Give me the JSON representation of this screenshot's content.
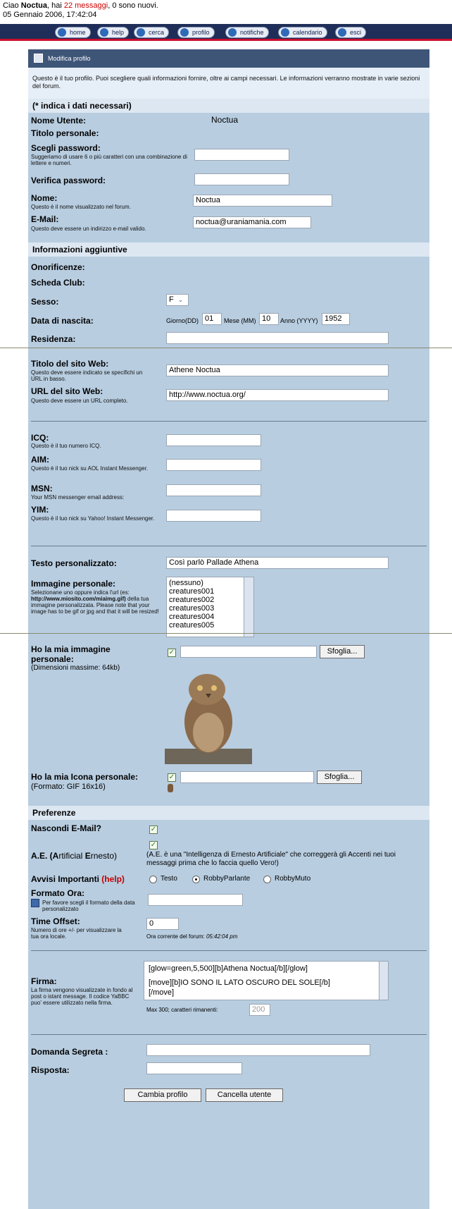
{
  "header": {
    "greeting_prefix": "Ciao ",
    "user": "Noctua",
    "greeting_mid": ", hai ",
    "messages": "22 messaggi",
    "greeting_suffix": ", 0 sono nuovi.",
    "datetime": "05 Gennaio 2006, 17:42:04"
  },
  "nav": [
    "home",
    "help",
    "cerca",
    "profilo",
    "notifiche",
    "calendario",
    "esci"
  ],
  "panel": {
    "title": "Modifica profilo",
    "intro": "Questo è il tuo profilo. Puoi scegliere quali informazioni fornire, oltre ai campi necessari. Le informazioni verranno mostrate in varie sezioni del forum."
  },
  "required": {
    "header": "(* indica i dati necessari)",
    "username_label": "Nome Utente:",
    "username_value": "Noctua",
    "title_label": "Titolo personale:",
    "password_label": "Scegli password:",
    "password_hint": "Suggeriamo di usare 6 o più caratteri con una combinazione di lettere e numeri.",
    "verify_label": "Verifica password:",
    "name_label": "Nome:",
    "name_hint": "Questo è il nome visualizzato nel forum.",
    "name_value": "Noctua",
    "email_label": "E-Mail:",
    "email_hint": "Questo deve essere un indirizzo e-mail valido.",
    "email_value": "noctua@uraniamania.com"
  },
  "extra": {
    "header": "Informazioni aggiuntive",
    "honors_label": "Onorificenze:",
    "club_label": "Scheda Club:",
    "sex_label": "Sesso:",
    "sex_value": "F",
    "birth_label": "Data di nascita:",
    "day_label": "Giorno(DD)",
    "day_value": "01",
    "month_label": "Mese (MM)",
    "month_value": "10",
    "year_label": "Anno (YYYY)",
    "year_value": "1952",
    "residence_label": "Residenza:",
    "site_title_label": "Titolo del sito Web:",
    "site_title_hint": "Questo deve essere indicato se specifichi un URL in basso.",
    "site_title_value": "Athene Noctua",
    "site_url_label": "URL del sito Web:",
    "site_url_hint": "Questo deve essere un URL completo.",
    "site_url_value": "http://www.noctua.org/",
    "icq_label": "ICQ:",
    "icq_hint": "Questo è il tuo numero ICQ.",
    "aim_label": "AIM:",
    "aim_hint": "Questo è il tuo nick su AOL Instant Messenger.",
    "msn_label": "MSN:",
    "msn_hint": "Your MSN messenger email address:",
    "yim_label": "YIM:",
    "yim_hint": "Questo è il tuo nick su Yahoo! Instant Messenger.",
    "custom_text_label": "Testo personalizzato:",
    "custom_text_value": "Così parlò Pallade Athena",
    "avatar_label": "Immagine personale:",
    "avatar_hint_1": "Selezionane uno oppure indica l'url (es:",
    "avatar_hint_url": "http://www.miosito.com/miaimg.gif)",
    "avatar_hint_2": "della tua immagine personalizzata. Please note that your image has to be gif or jpg and that it will be resized!",
    "avatar_options": [
      "(nessuno)",
      "creatures001",
      "creatures002",
      "creatures003",
      "creatures004",
      "creatures005"
    ],
    "own_image_label": "Ho la mia immagine personale:",
    "own_image_hint": "(Dimensioni massime: 64kb)",
    "browse_label": "Sfoglia...",
    "own_icon_label": "Ho la mia Icona personale:",
    "own_icon_hint": "(Formato: GIF 16x16)"
  },
  "prefs": {
    "header": "Preferenze",
    "hide_email_label": "Nascondi E-Mail?",
    "ae_label_1": "A.E. (",
    "ae_label_a": "A",
    "ae_label_2": "rtificial ",
    "ae_label_e": "E",
    "ae_label_3": "rnesto)",
    "ae_desc": "(A.E. è una \"Intelligenza di Ernesto Artificiale\" che correggerà gli Accenti nei tuoi messaggi prima che lo faccia quello Vero!)",
    "alerts_label": "Avvisi Importanti",
    "alerts_help": "(help)",
    "radio_options": [
      "Testo",
      "RobbyParlante",
      "RobbyMuto"
    ],
    "time_format_label": "Formato Ora:",
    "time_format_hint": "Per favore scegli il formato della data personalizzato",
    "offset_label": "Time Offset:",
    "offset_hint": "Numero di ore +/- per visualizzare la tua ora locale.",
    "offset_value": "0",
    "forum_time_label": "Ora corrente del forum:",
    "forum_time_value": "05:42:04 pm",
    "signature_label": "Firma:",
    "signature_hint": "La firma vengono visualizzate in fondo al post o istant message. Il codice YaBBC puo' essere utilizzato nella firma.",
    "signature_line1": "[glow=green,5,500][b]Athena Noctua[/b][/glow]",
    "signature_line2": "[move][b]IO SONO IL LATO OSCURO DEL SOLE[/b]",
    "signature_line3": "[/move]",
    "max_label": "Max 300; caratteri rimanenti:",
    "max_value": "200",
    "secret_q_label": "Domanda Segreta :",
    "answer_label": "Risposta:"
  },
  "buttons": {
    "save": "Cambia profilo",
    "delete": "Cancella utente"
  },
  "colors": {
    "navbar": "#1e2e58",
    "accent_red": "#c8102e",
    "panel": "#b8cde0",
    "title_bar": "#3e5578"
  }
}
